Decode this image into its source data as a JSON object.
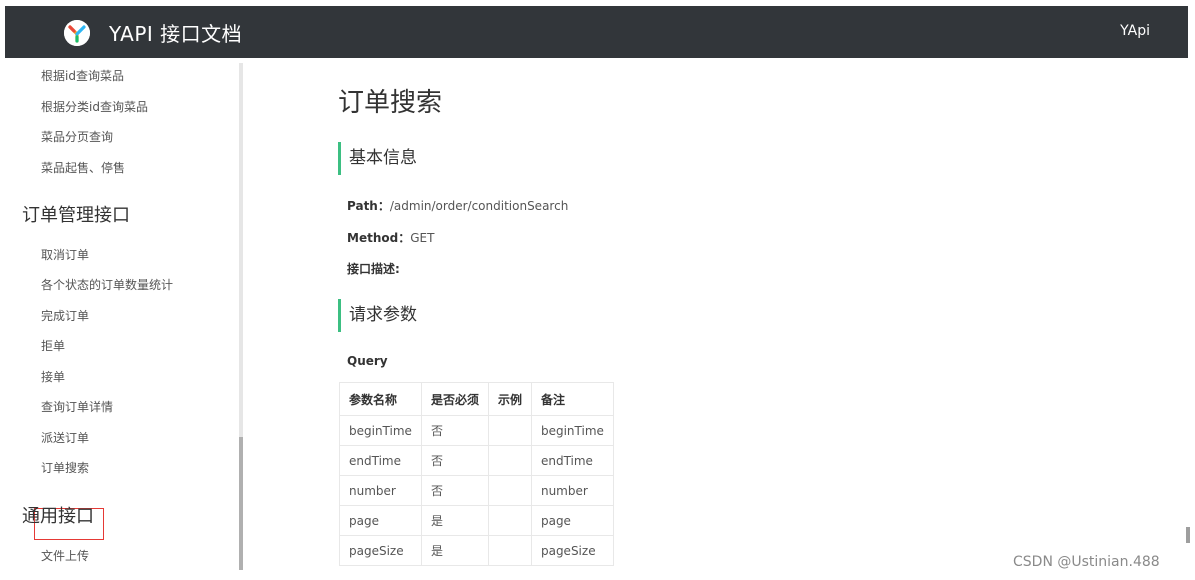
{
  "header": {
    "app_title": "YAPI 接口文档",
    "right_label": "YApi"
  },
  "sidebar": {
    "items_top": [
      "根据id查询菜品",
      "根据分类id查询菜品",
      "菜品分页查询",
      "菜品起售、停售"
    ],
    "group_order": "订单管理接口",
    "items_order": [
      "取消订单",
      "各个状态的订单数量统计",
      "完成订单",
      "拒单",
      "接单",
      "查询订单详情",
      "派送订单",
      "订单搜索"
    ],
    "group_common": "通用接口",
    "items_common": [
      "文件上传"
    ]
  },
  "main": {
    "title": "订单搜索",
    "section_basic": "基本信息",
    "path_label": "Path：",
    "path_value": "/admin/order/conditionSearch",
    "method_label": "Method：",
    "method_value": "GET",
    "desc_label": "接口描述:",
    "section_request": "请求参数",
    "query_label": "Query",
    "table": {
      "headers": [
        "参数名称",
        "是否必须",
        "示例",
        "备注"
      ],
      "rows": [
        [
          "beginTime",
          "否",
          "",
          "beginTime"
        ],
        [
          "endTime",
          "否",
          "",
          "endTime"
        ],
        [
          "number",
          "否",
          "",
          "number"
        ],
        [
          "page",
          "是",
          "",
          "page"
        ],
        [
          "pageSize",
          "是",
          "",
          "pageSize"
        ]
      ]
    }
  },
  "watermark": "CSDN @Ustinian.488",
  "colors": {
    "topbar": "#32363a",
    "accent": "#3cbf82",
    "highlight_border": "#e53935"
  }
}
